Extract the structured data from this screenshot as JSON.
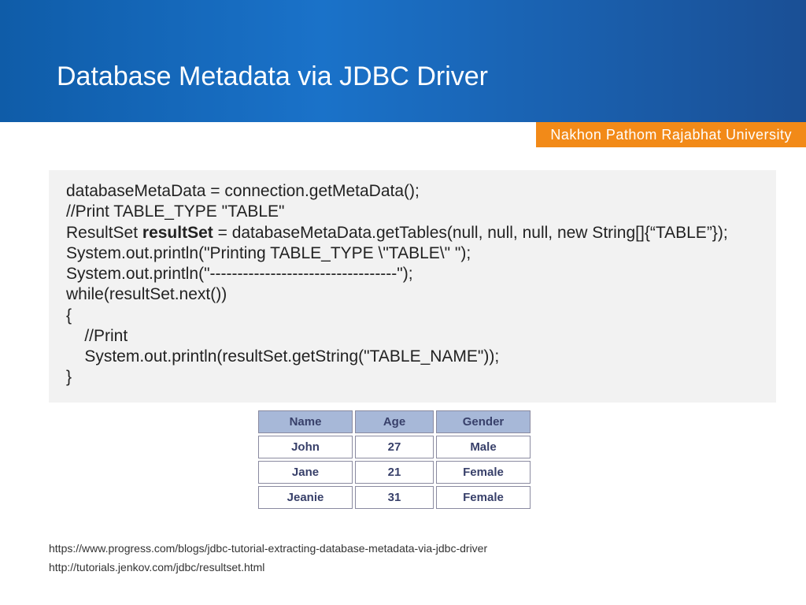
{
  "title": "Database Metadata via JDBC Driver",
  "subtitle": "Nakhon Pathom Rajabhat University",
  "code": {
    "l1": "databaseMetaData = connection.getMetaData();",
    "l2": "//Print TABLE_TYPE \"TABLE\"",
    "l3a": "ResultSet ",
    "l3b": "resultSet",
    "l3c": " = databaseMetaData.getTables(null, null, null, new String[]{“TABLE”});",
    "l4": "System.out.println(\"Printing TABLE_TYPE \\\"TABLE\\\" \");",
    "l5": "System.out.println(\"----------------------------------\");",
    "l6": "while(resultSet.next())",
    "l7": "{",
    "l8": "    //Print",
    "l9": "    System.out.println(resultSet.getString(\"TABLE_NAME\"));",
    "l10": "}"
  },
  "table": {
    "headers": [
      "Name",
      "Age",
      "Gender"
    ],
    "rows": [
      [
        "John",
        "27",
        "Male"
      ],
      [
        "Jane",
        "21",
        "Female"
      ],
      [
        "Jeanie",
        "31",
        "Female"
      ]
    ]
  },
  "refs": {
    "r1": "https://www.progress.com/blogs/jdbc-tutorial-extracting-database-metadata-via-jdbc-driver",
    "r2": "http://tutorials.jenkov.com/jdbc/resultset.html"
  }
}
